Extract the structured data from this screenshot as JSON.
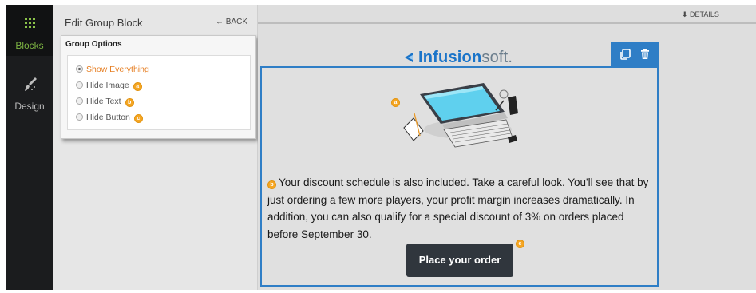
{
  "rail": {
    "items": [
      {
        "label": "Blocks",
        "icon": "grid-icon",
        "active": true
      },
      {
        "label": "Design",
        "icon": "brush-icon",
        "active": false
      }
    ]
  },
  "panel": {
    "title": "Edit Group Block",
    "back_label": "← BACK",
    "group_options": {
      "title": "Group Options",
      "options": [
        {
          "label": "Show Everything",
          "selected": true,
          "badge": ""
        },
        {
          "label": "Hide Image",
          "selected": false,
          "badge": "a"
        },
        {
          "label": "Hide Text",
          "selected": false,
          "badge": "b"
        },
        {
          "label": "Hide Button",
          "selected": false,
          "badge": "c"
        }
      ]
    }
  },
  "canvas": {
    "details_label": "⬇ DETAILS",
    "logo": {
      "bold": "Infusion",
      "thin": "soft."
    },
    "image_badge": "a",
    "text_badge": "b",
    "button_badge": "c",
    "paragraph": "Your discount schedule is also included. Take a careful look. You'll see that by just ordering a few more players, your profit margin increases dramatically. In addition, you can also qualify for a special discount of 3% on orders placed before September 30.",
    "button_label": "Place your order"
  },
  "colors": {
    "accent_blue": "#2f7ec6",
    "badge_orange": "#f5a623",
    "selected_orange": "#e67e22",
    "rail_green": "#7cb342"
  }
}
